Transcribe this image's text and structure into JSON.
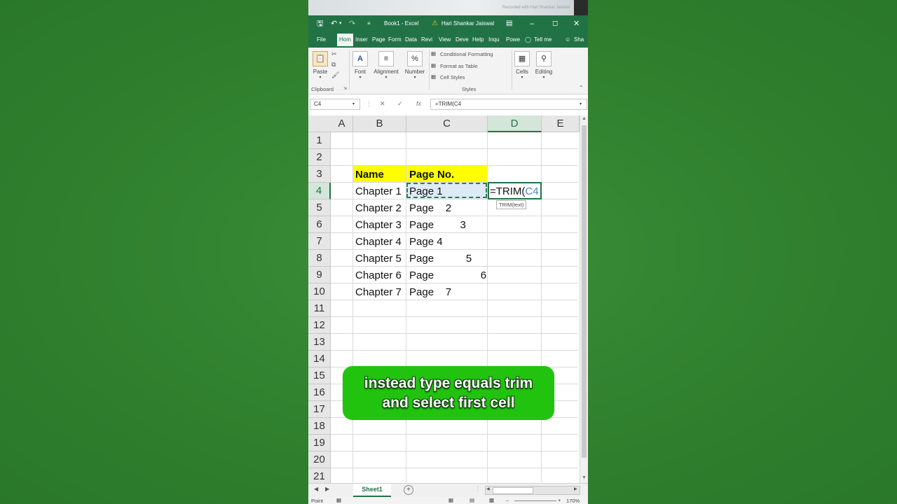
{
  "window": {
    "workbook_title": "Book1  -  Excel",
    "user_name": "Hari Shankar Jaiswal",
    "watermark": "Recorded with Hari Shankar Jaiswal"
  },
  "ribbon": {
    "tabs": [
      "File",
      "Hom",
      "Inser",
      "Page",
      "Form",
      "Data",
      "Revi",
      "View",
      "Deve",
      "Help",
      "Inqu",
      "Powe",
      "Tell me",
      "Sha"
    ],
    "active_tab": "Hom",
    "paste_label": "Paste",
    "clipboard_label": "Clipboard",
    "font_label": "Font",
    "alignment_label": "Alignment",
    "number_label": "Number",
    "conditional_formatting": "Conditional Formatting",
    "format_as_table": "Format as Table",
    "cell_styles": "Cell Styles",
    "styles_label": "Styles",
    "cells_label": "Cells",
    "editing_label": "Editing"
  },
  "formula_bar": {
    "name_box": "C4",
    "formula": "=TRIM(C4"
  },
  "grid": {
    "columns": [
      "A",
      "B",
      "C",
      "D",
      "E"
    ],
    "selected_column": "D",
    "rows": [
      "1",
      "2",
      "3",
      "4",
      "5",
      "6",
      "7",
      "8",
      "9",
      "10",
      "11",
      "12",
      "13",
      "14",
      "15",
      "16",
      "17",
      "18",
      "19",
      "20",
      "21"
    ],
    "selected_row": "4",
    "header_name": "Name",
    "header_page": "Page No.",
    "b_values": [
      "Chapter 1",
      "Chapter 2",
      "Chapter 3",
      "Chapter 4",
      "Chapter 5",
      "Chapter 6",
      "Chapter 7"
    ],
    "c_values": [
      "Page 1",
      "Page    2",
      "Page         3",
      "Page 4",
      "Page           5",
      "Page                6",
      "Page    7"
    ],
    "active_cell_prefix": "=TRIM(",
    "active_cell_ref": "C4",
    "function_tooltip": "TRIM(text)"
  },
  "sheets": {
    "tab_name": "Sheet1"
  },
  "status": {
    "mode": "Point",
    "zoom": "170%"
  },
  "caption": {
    "line1": "instead type equals trim",
    "line2": "and select first cell"
  },
  "colors": {
    "excel_green": "#217346",
    "header_fill": "#ffff00",
    "caption_bg": "#22c30f",
    "background": "#2f7f2e"
  }
}
